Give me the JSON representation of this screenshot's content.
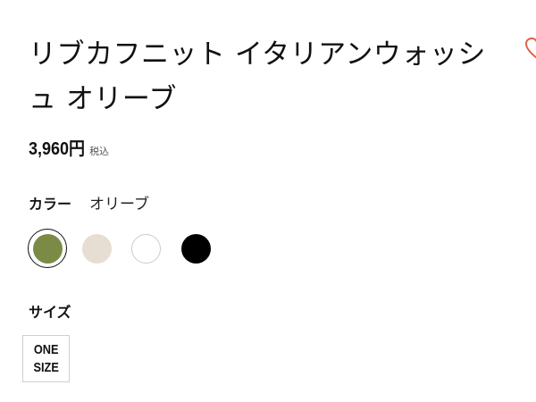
{
  "product": {
    "title": "リブカフニット イタリアンウォッシュ オリーブ",
    "price": "3,960円",
    "tax_note": "税込"
  },
  "color": {
    "label": "カラー",
    "selected": "オリーブ",
    "swatches": [
      {
        "name": "olive",
        "hex": "#7b8b45",
        "selected": true
      },
      {
        "name": "beige",
        "hex": "#e6ddd3",
        "selected": false
      },
      {
        "name": "white",
        "hex": "#ffffff",
        "selected": false
      },
      {
        "name": "black",
        "hex": "#000000",
        "selected": false
      }
    ]
  },
  "size": {
    "label": "サイズ",
    "options": [
      "ONE\nSIZE"
    ]
  },
  "icons": {
    "favorite": "heart-icon"
  },
  "colors": {
    "accent": "#e0604a",
    "text": "#111111"
  }
}
